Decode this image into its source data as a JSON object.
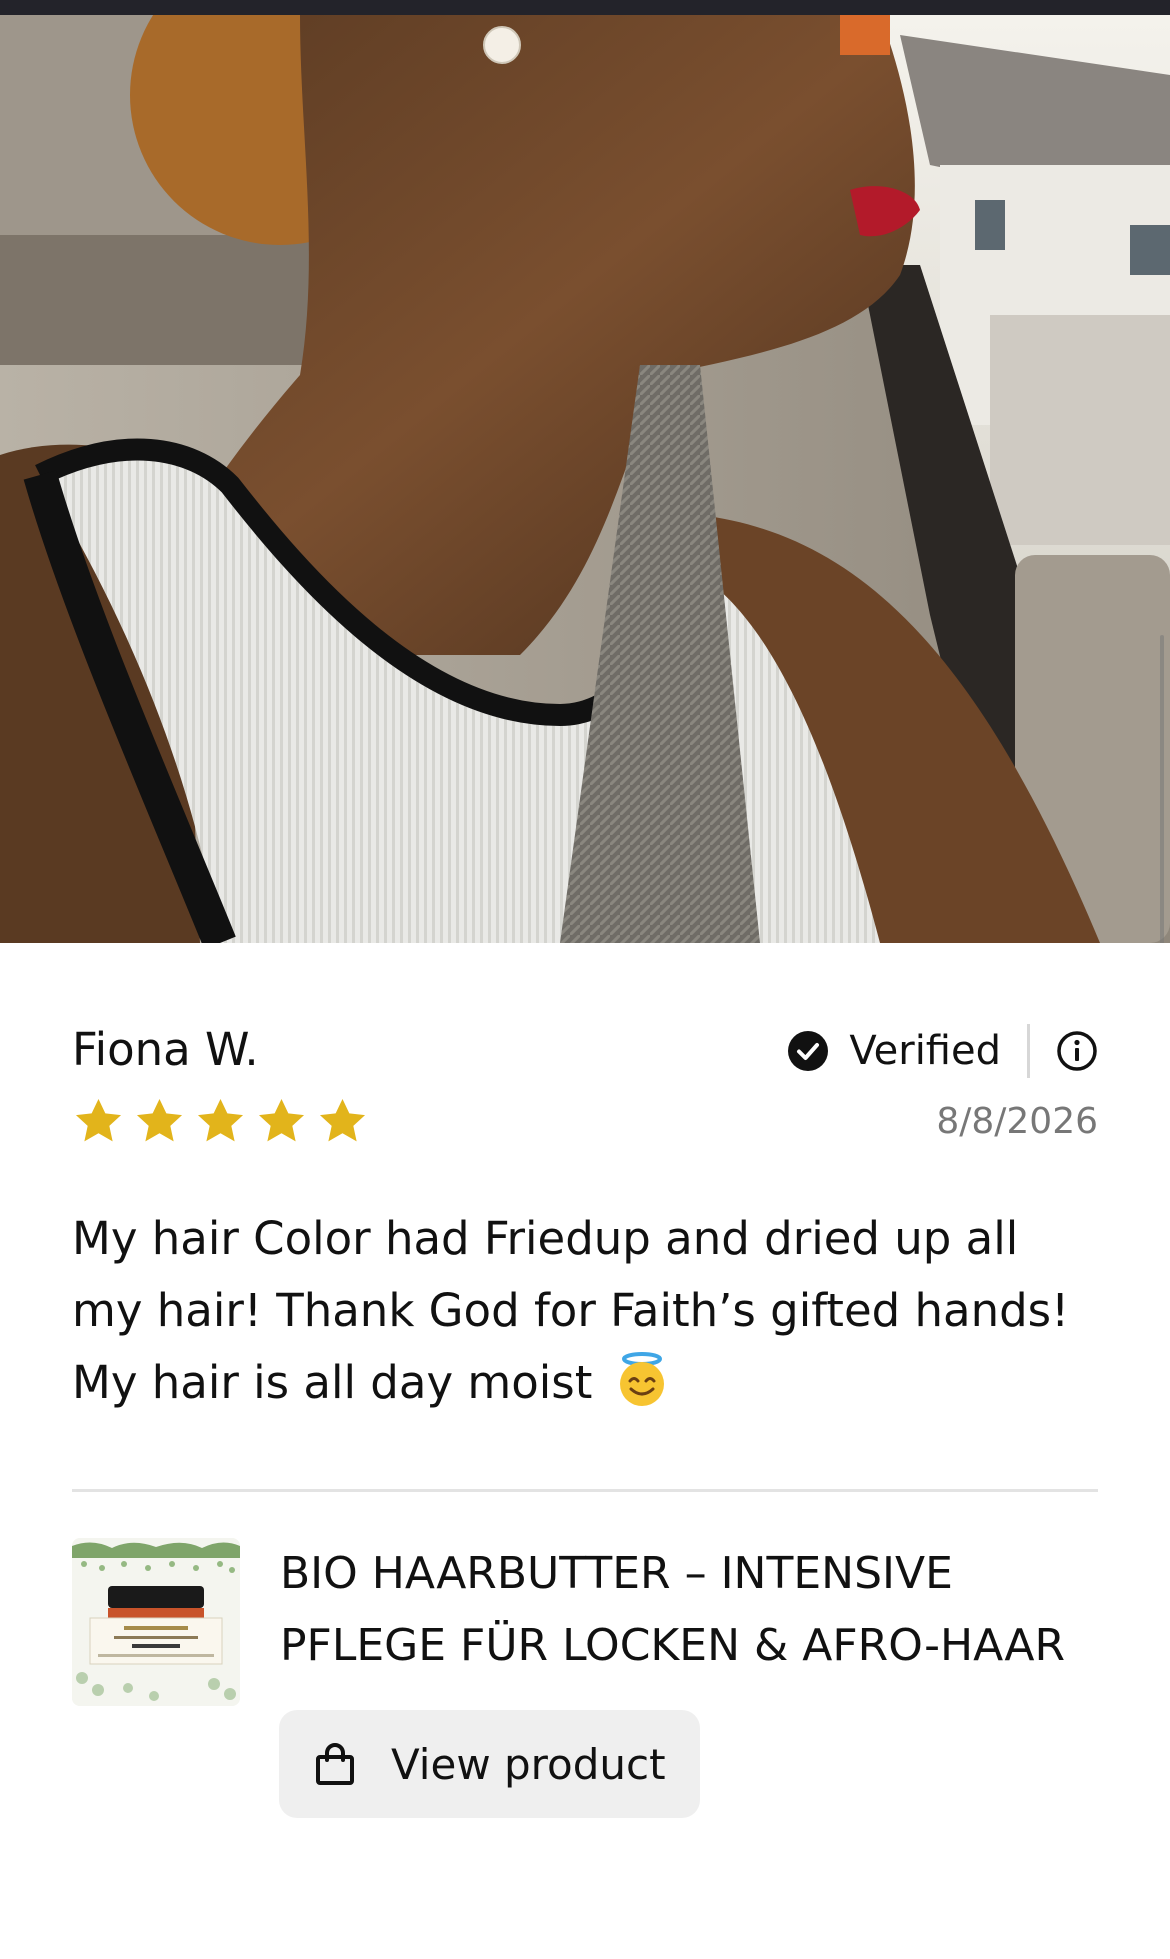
{
  "review": {
    "author": "Fiona W.",
    "verified_label": "Verified",
    "rating": 5,
    "rating_max": 5,
    "date": "8/8/2026",
    "text": "My hair Color had Friedup and dried up all my hair! Thank God for Faith’s gifted hands! My hair is all day moist",
    "emoji": "smiling-face-with-halo"
  },
  "product": {
    "name": "BIO HAARBUTTER – INTENSIVE PFLEGE FÜR LOCKEN & AFRO-HAAR",
    "view_label": "View product"
  },
  "colors": {
    "star": "#E2B41B",
    "badge": "#111111",
    "date_text": "#777777",
    "button_bg": "#EFEFEF",
    "divider": "#E3E3E3"
  },
  "icons": [
    "verified-check-icon",
    "info-icon",
    "star-icon",
    "shopping-bag-icon",
    "angel-emoji-icon"
  ]
}
